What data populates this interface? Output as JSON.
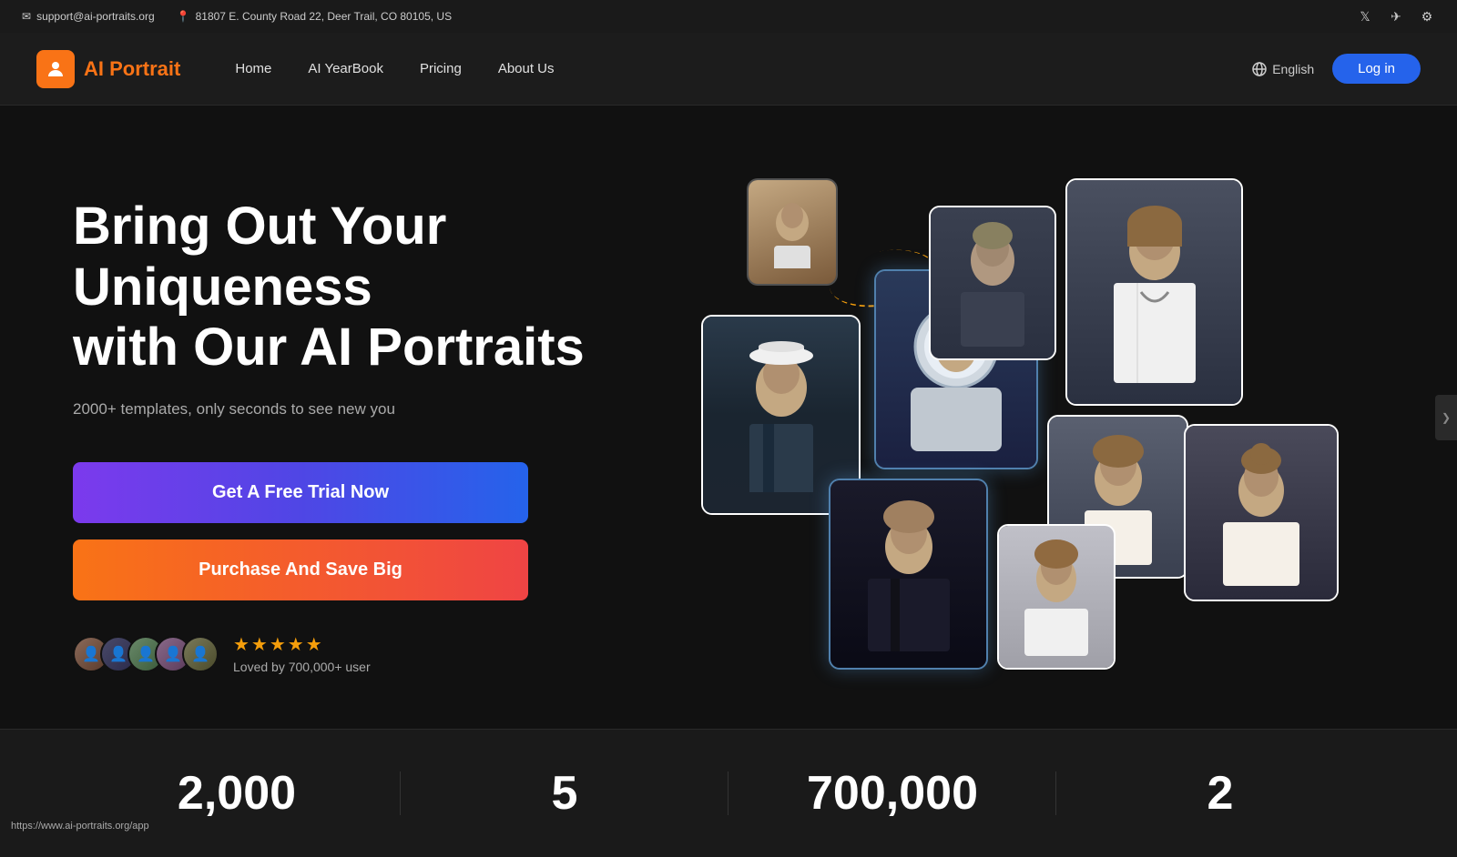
{
  "topbar": {
    "email": "support@ai-portraits.org",
    "address": "81807 E. County Road 22, Deer Trail, CO 80105, US",
    "email_icon": "✉",
    "location_icon": "📍"
  },
  "navbar": {
    "logo_text": "AI Portrait",
    "nav_links": [
      {
        "id": "home",
        "label": "Home"
      },
      {
        "id": "ai-yearbook",
        "label": "AI YearBook"
      },
      {
        "id": "pricing",
        "label": "Pricing"
      },
      {
        "id": "about",
        "label": "About Us"
      }
    ],
    "lang_label": "English",
    "login_label": "Log in"
  },
  "hero": {
    "title_line1": "Bring Out Your Uniqueness",
    "title_line2": "with Our AI Portraits",
    "subtitle": "2000+ templates, only seconds to see new you",
    "btn_trial": "Get A Free Trial Now",
    "btn_purchase": "Purchase And Save Big",
    "social_proof_text": "Loved by 700,000+ user",
    "stars": "★★★★★"
  },
  "stats": [
    {
      "number": "2,000",
      "label": ""
    },
    {
      "number": "5",
      "label": ""
    },
    {
      "number": "700,000",
      "label": ""
    },
    {
      "number": "2",
      "label": ""
    }
  ],
  "status_bar": {
    "url": "https://www.ai-portraits.org/app"
  }
}
